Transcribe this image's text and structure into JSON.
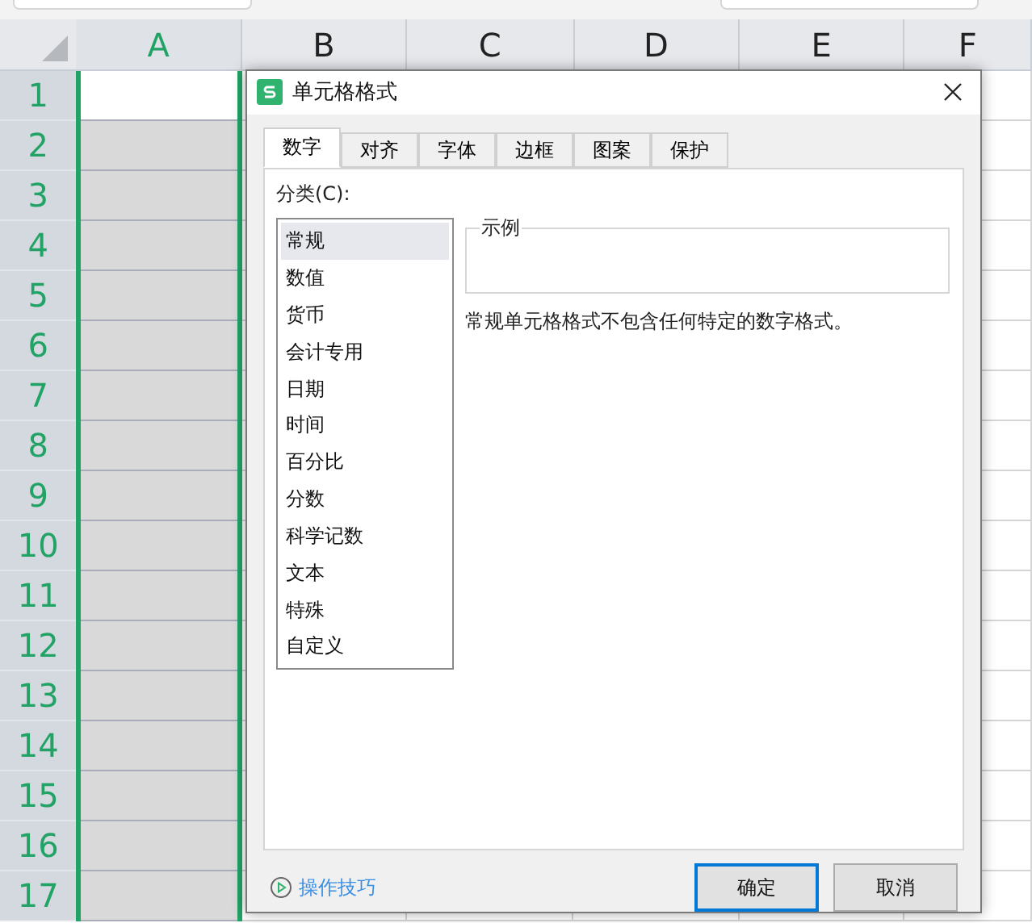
{
  "columns": [
    {
      "label": "A",
      "selected": true
    },
    {
      "label": "B",
      "selected": false
    },
    {
      "label": "C",
      "selected": false
    },
    {
      "label": "D",
      "selected": false
    },
    {
      "label": "E",
      "selected": false
    },
    {
      "label": "F",
      "selected": false
    }
  ],
  "rows": [
    "1",
    "2",
    "3",
    "4",
    "5",
    "6",
    "7",
    "8",
    "9",
    "10",
    "11",
    "12",
    "13",
    "14",
    "15",
    "16",
    "17"
  ],
  "dialog": {
    "title": "单元格格式",
    "tabs": [
      {
        "label": "数字",
        "selected": true
      },
      {
        "label": "对齐",
        "selected": false
      },
      {
        "label": "字体",
        "selected": false
      },
      {
        "label": "边框",
        "selected": false
      },
      {
        "label": "图案",
        "selected": false
      },
      {
        "label": "保护",
        "selected": false
      }
    ],
    "category_label": "分类(C):",
    "categories": [
      {
        "label": "常规",
        "selected": true
      },
      {
        "label": "数值",
        "selected": false
      },
      {
        "label": "货币",
        "selected": false
      },
      {
        "label": "会计专用",
        "selected": false
      },
      {
        "label": "日期",
        "selected": false
      },
      {
        "label": "时间",
        "selected": false
      },
      {
        "label": "百分比",
        "selected": false
      },
      {
        "label": "分数",
        "selected": false
      },
      {
        "label": "科学记数",
        "selected": false
      },
      {
        "label": "文本",
        "selected": false
      },
      {
        "label": "特殊",
        "selected": false
      },
      {
        "label": "自定义",
        "selected": false
      }
    ],
    "sample_label": "示例",
    "description": "常规单元格格式不包含任何特定的数字格式。",
    "tips_link": "操作技巧",
    "buttons": [
      {
        "label": "确定",
        "kind": "primary"
      },
      {
        "label": "取消",
        "kind": "secondary"
      }
    ]
  }
}
